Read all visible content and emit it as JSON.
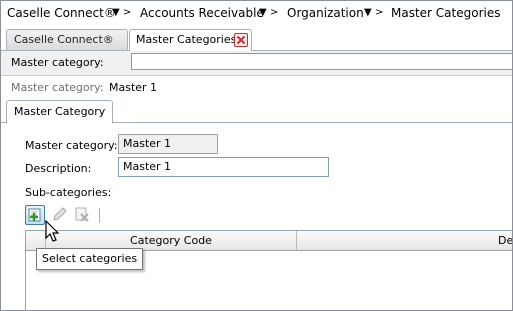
{
  "breadcrumb": {
    "items": [
      "Caselle Connect®",
      "Accounts Receivable",
      "Organization",
      "Master Categories"
    ],
    "separator": ">"
  },
  "tabs": [
    {
      "label": "Caselle Connect®",
      "active": false
    },
    {
      "label": "Master Categories",
      "active": true,
      "closable": true
    }
  ],
  "filter": {
    "label": "Master category:",
    "value": ""
  },
  "summary": {
    "label": "Master category:",
    "value": "Master 1"
  },
  "inner_tab": {
    "label": "Master Category"
  },
  "form": {
    "master_category_label": "Master category:",
    "master_category_value": "Master 1",
    "description_label": "Description:",
    "description_value": "Master 1",
    "subcategories_label": "Sub-categories:"
  },
  "toolbar": {
    "icons": [
      "select-categories-icon",
      "edit-icon",
      "delete-icon"
    ]
  },
  "grid": {
    "columns": [
      "Category Code",
      "De"
    ]
  },
  "tooltip": {
    "text": "Select categories"
  },
  "colors": {
    "border": "#a6b0bd",
    "input_border": "#7f9db9",
    "close_red": "#c03030"
  }
}
